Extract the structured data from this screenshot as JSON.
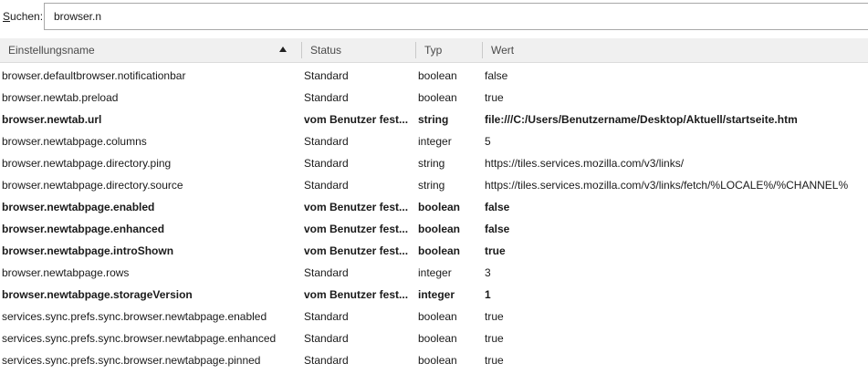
{
  "search": {
    "label_accel": "S",
    "label_rest": "uchen:",
    "value": "browser.n"
  },
  "columns": {
    "name": "Einstellungsname",
    "status": "Status",
    "type": "Typ",
    "value": "Wert"
  },
  "rows": [
    {
      "name": "browser.defaultbrowser.notificationbar",
      "status": "Standard",
      "type": "boolean",
      "value": "false",
      "modified": false
    },
    {
      "name": "browser.newtab.preload",
      "status": "Standard",
      "type": "boolean",
      "value": "true",
      "modified": false
    },
    {
      "name": "browser.newtab.url",
      "status": "vom Benutzer fest...",
      "type": "string",
      "value": "file:///C:/Users/Benutzername/Desktop/Aktuell/startseite.htm",
      "modified": true
    },
    {
      "name": "browser.newtabpage.columns",
      "status": "Standard",
      "type": "integer",
      "value": "5",
      "modified": false
    },
    {
      "name": "browser.newtabpage.directory.ping",
      "status": "Standard",
      "type": "string",
      "value": "https://tiles.services.mozilla.com/v3/links/",
      "modified": false
    },
    {
      "name": "browser.newtabpage.directory.source",
      "status": "Standard",
      "type": "string",
      "value": "https://tiles.services.mozilla.com/v3/links/fetch/%LOCALE%/%CHANNEL%",
      "modified": false
    },
    {
      "name": "browser.newtabpage.enabled",
      "status": "vom Benutzer fest...",
      "type": "boolean",
      "value": "false",
      "modified": true
    },
    {
      "name": "browser.newtabpage.enhanced",
      "status": "vom Benutzer fest...",
      "type": "boolean",
      "value": "false",
      "modified": true
    },
    {
      "name": "browser.newtabpage.introShown",
      "status": "vom Benutzer fest...",
      "type": "boolean",
      "value": "true",
      "modified": true
    },
    {
      "name": "browser.newtabpage.rows",
      "status": "Standard",
      "type": "integer",
      "value": "3",
      "modified": false
    },
    {
      "name": "browser.newtabpage.storageVersion",
      "status": "vom Benutzer fest...",
      "type": "integer",
      "value": "1",
      "modified": true
    },
    {
      "name": "services.sync.prefs.sync.browser.newtabpage.enabled",
      "status": "Standard",
      "type": "boolean",
      "value": "true",
      "modified": false
    },
    {
      "name": "services.sync.prefs.sync.browser.newtabpage.enhanced",
      "status": "Standard",
      "type": "boolean",
      "value": "true",
      "modified": false
    },
    {
      "name": "services.sync.prefs.sync.browser.newtabpage.pinned",
      "status": "Standard",
      "type": "boolean",
      "value": "true",
      "modified": false
    }
  ]
}
